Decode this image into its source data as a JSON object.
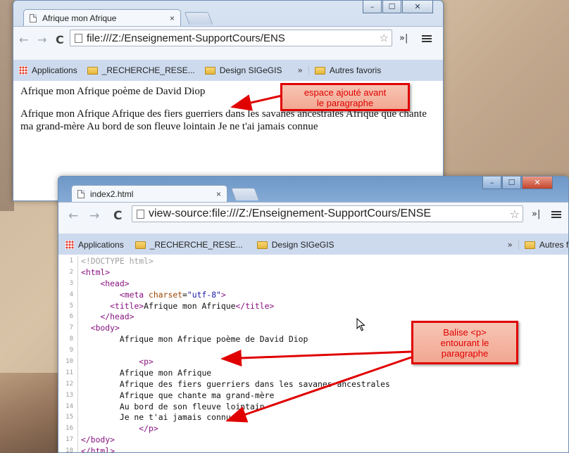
{
  "window1": {
    "tab_title": "Afrique mon Afrique",
    "tab_close": "×",
    "address": "file:///Z:/Enseignement-SupportCours/ENS",
    "bookmarks": [
      "Applications",
      "_RECHERCHE_RESE...",
      "Design SIGeGIS"
    ],
    "bookmark_more": "»",
    "other_bookmarks": "Autres favoris",
    "heading_text": "Afrique mon Afrique poème de David Diop",
    "paragraph": "Afrique mon Afrique Afrique des fiers guerriers dans les savanes ancestrales Afrique que chante ma grand-mère Au bord de son fleuve lointain Je ne t'ai jamais connue",
    "controls": {
      "minimize": "–",
      "maximize": "☐",
      "close": "✕"
    }
  },
  "window2": {
    "tab_title": "index2.html",
    "tab_close": "×",
    "address": "view-source:file:///Z:/Enseignement-SupportCours/ENSE",
    "bookmarks": [
      "Applications",
      "_RECHERCHE_RESE...",
      "Design SIGeGIS"
    ],
    "bookmark_more": "»",
    "other_bookmarks": "Autres favoris",
    "controls": {
      "minimize": "–",
      "maximize": "☐",
      "close": "✕"
    },
    "source_lines": [
      {
        "n": "1",
        "text": "<!DOCTYPE html>"
      },
      {
        "n": "2",
        "text": "<html>"
      },
      {
        "n": "3",
        "text": "    <head>"
      },
      {
        "n": "4",
        "text": "        <meta charset=\"utf-8\">"
      },
      {
        "n": "5",
        "text": "      <title>Afrique mon Afrique</title>"
      },
      {
        "n": "6",
        "text": "    </head>"
      },
      {
        "n": "7",
        "text": "  <body>"
      },
      {
        "n": "8",
        "text": "        Afrique mon Afrique poème de David Diop"
      },
      {
        "n": "9",
        "text": ""
      },
      {
        "n": "10",
        "text": "            <p>"
      },
      {
        "n": "11",
        "text": "        Afrique mon Afrique"
      },
      {
        "n": "12",
        "text": "        Afrique des fiers guerriers dans les savanes ancestrales"
      },
      {
        "n": "13",
        "text": "        Afrique que chante ma grand-mère"
      },
      {
        "n": "14",
        "text": "        Au bord de son fleuve lointain"
      },
      {
        "n": "15",
        "text": "        Je ne t'ai jamais connue"
      },
      {
        "n": "16",
        "text": "            </p>"
      },
      {
        "n": "17",
        "text": "</body>"
      },
      {
        "n": "18",
        "text": "</html>"
      }
    ]
  },
  "annotations": {
    "callout1": [
      "espace ajouté avant",
      "le paragraphe"
    ],
    "callout2": [
      "Balise <p>",
      "entourant le",
      "paragraphe"
    ]
  },
  "colors": {
    "annotation_red": "#e00000",
    "callout_fill": "#f4b8a6"
  }
}
